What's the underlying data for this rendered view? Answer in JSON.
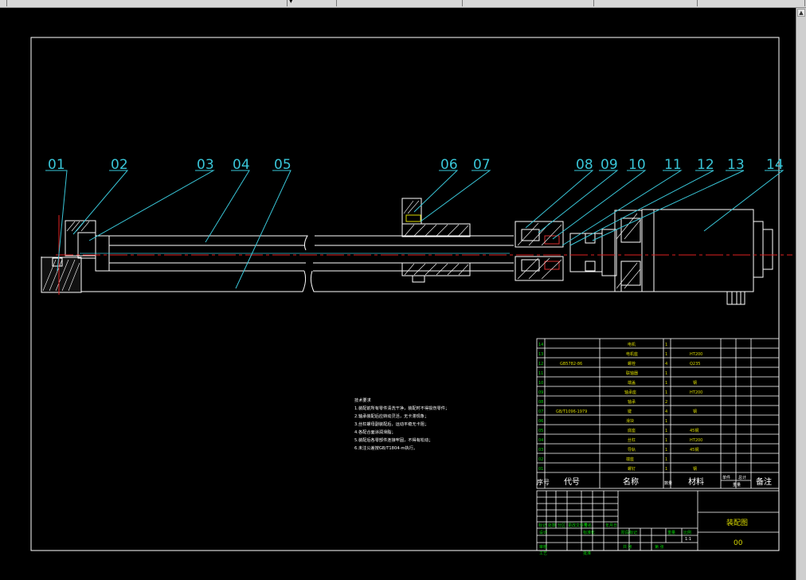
{
  "callouts": [
    "01",
    "02",
    "03",
    "04",
    "05",
    "06",
    "07",
    "08",
    "09",
    "10",
    "11",
    "12",
    "13",
    "14"
  ],
  "notes": {
    "title": "技术要求",
    "lines": [
      "1.装配前所有零件清洗干净，装配时不得损伤零件；",
      "2.轴承装配后应转动灵活，无卡滞现象；",
      "3.丝杠螺母副装配后，运动平稳无卡阻；",
      "4.各配合面涂润滑脂；",
      "5.装配后各零部件连接牢固，不得有松动；",
      "6.未注公差按GB/T1804-m执行。"
    ]
  },
  "bom": {
    "rows": [
      {
        "no": "14",
        "code": "",
        "name": "电机",
        "qty": "1",
        "mat": ""
      },
      {
        "no": "13",
        "code": "",
        "name": "电机座",
        "qty": "1",
        "mat": "HT200"
      },
      {
        "no": "12",
        "code": "GB5782-86",
        "name": "螺栓",
        "qty": "4",
        "mat": "Q235"
      },
      {
        "no": "11",
        "code": "",
        "name": "联轴器",
        "qty": "1",
        "mat": ""
      },
      {
        "no": "10",
        "code": "",
        "name": "端盖",
        "qty": "1",
        "mat": "钢"
      },
      {
        "no": "09",
        "code": "",
        "name": "轴承座",
        "qty": "1",
        "mat": "HT200"
      },
      {
        "no": "08",
        "code": "",
        "name": "轴承",
        "qty": "2",
        "mat": ""
      },
      {
        "no": "07",
        "code": "GB/T1096-1979",
        "name": "键",
        "qty": "4",
        "mat": "钢"
      },
      {
        "no": "06",
        "code": "",
        "name": "滑块",
        "qty": "1",
        "mat": ""
      },
      {
        "no": "05",
        "code": "",
        "name": "底座",
        "qty": "1",
        "mat": "45钢"
      },
      {
        "no": "04",
        "code": "",
        "name": "丝杠",
        "qty": "1",
        "mat": "HT200"
      },
      {
        "no": "03",
        "code": "",
        "name": "导轨",
        "qty": "1",
        "mat": "45钢"
      },
      {
        "no": "02",
        "code": "",
        "name": "端座",
        "qty": "1",
        "mat": ""
      },
      {
        "no": "01",
        "code": "",
        "name": "螺钉",
        "qty": "1",
        "mat": "钢"
      }
    ],
    "header": {
      "no": "序号",
      "code": "代号",
      "name": "名称",
      "qty": "数量",
      "mat": "材料",
      "unit_w": "单件",
      "total_w": "总计",
      "weight": "重量",
      "remark": "备注"
    }
  },
  "titleblock": {
    "drawing_name": "装配图",
    "drawing_no": "00",
    "cells": {
      "mark": "标记",
      "count": "处数",
      "zone": "分区",
      "doc": "更改文件号",
      "sign": "签名",
      "date": "年月日",
      "design": "设计",
      "standard": "标准化",
      "stage": "阶段标记",
      "weight": "重量",
      "scale": "比例",
      "check": "审核",
      "process": "工艺",
      "approve": "批准",
      "sheet_total": "共 张",
      "sheet_no": "第 张",
      "scale_val": "1:1"
    }
  }
}
